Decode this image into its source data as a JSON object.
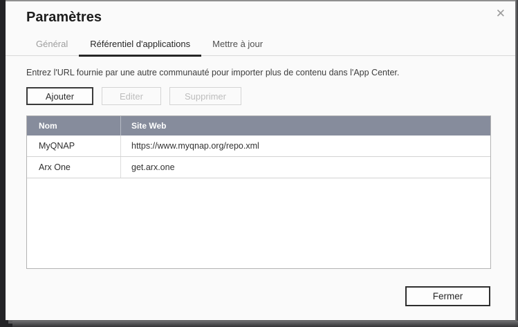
{
  "dialog": {
    "title": "Paramètres",
    "close_glyph": "✕"
  },
  "tabs": [
    {
      "label": "Général",
      "active": false
    },
    {
      "label": "Référentiel d'applications",
      "active": true
    },
    {
      "label": "Mettre à jour",
      "active": false
    }
  ],
  "description": "Entrez l'URL fournie par une autre communauté pour importer plus de contenu dans l'App Center.",
  "toolbar": {
    "add_label": "Ajouter",
    "edit_label": "Editer",
    "delete_label": "Supprimer"
  },
  "table": {
    "columns": [
      "Nom",
      "Site Web"
    ],
    "rows": [
      {
        "name": "MyQNAP",
        "url": "https://www.myqnap.org/repo.xml"
      },
      {
        "name": "Arx One",
        "url": "get.arx.one"
      }
    ]
  },
  "footer": {
    "close_label": "Fermer"
  },
  "colors": {
    "table_header_bg": "#868c9c",
    "accent_dark": "#2b2b2b",
    "dialog_bg": "#fafafa"
  }
}
